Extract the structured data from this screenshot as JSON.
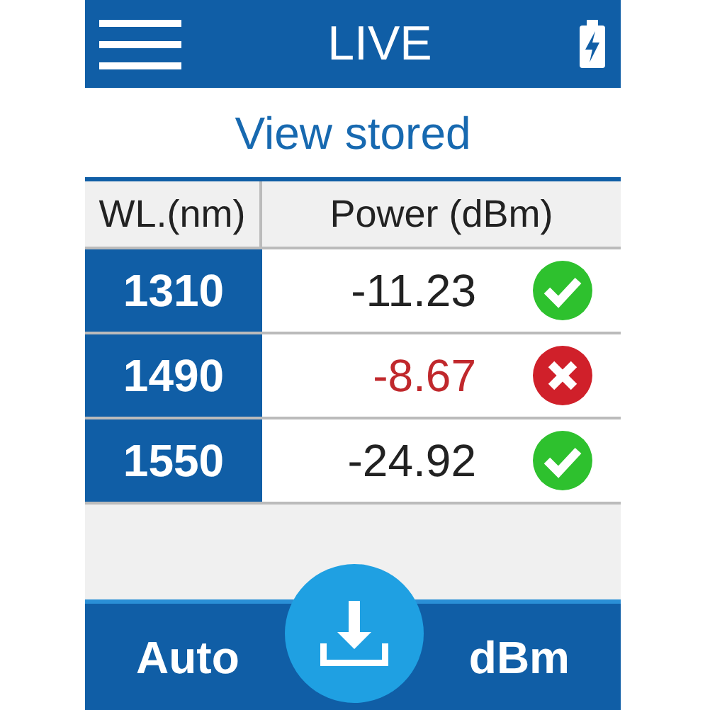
{
  "header": {
    "title": "LIVE"
  },
  "view_stored": "View stored",
  "table": {
    "columns": [
      "WL.(nm)",
      "Power (dBm)"
    ],
    "rows": [
      {
        "wavelength": "1310",
        "power": "-11.23",
        "passed": true
      },
      {
        "wavelength": "1490",
        "power": "-8.67",
        "passed": false
      },
      {
        "wavelength": "1550",
        "power": "-24.92",
        "passed": true
      }
    ]
  },
  "footer": {
    "left": "Auto",
    "right": "dBm"
  }
}
